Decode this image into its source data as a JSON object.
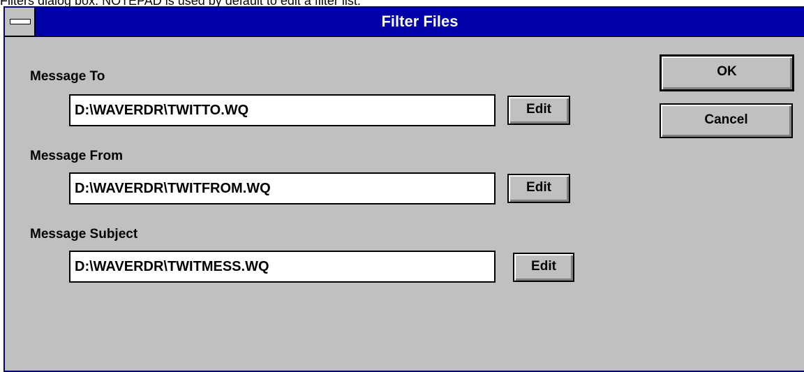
{
  "caption": "Filters dialog box. NOTEPAD is used by default to edit a filter list.",
  "window": {
    "title": "Filter Files"
  },
  "fields": [
    {
      "label": "Message To",
      "value": "D:\\WAVERDR\\TWITTO.WQ",
      "edit_label": "Edit"
    },
    {
      "label": "Message From",
      "value": "D:\\WAVERDR\\TWITFROM.WQ",
      "edit_label": "Edit"
    },
    {
      "label": "Message Subject",
      "value": "D:\\WAVERDR\\TWITMESS.WQ",
      "edit_label": "Edit"
    }
  ],
  "buttons": {
    "ok": "OK",
    "cancel": "Cancel"
  }
}
